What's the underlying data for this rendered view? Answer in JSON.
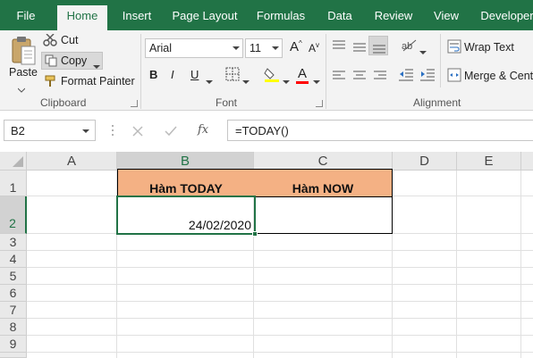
{
  "tabs": [
    "File",
    "Home",
    "Insert",
    "Page Layout",
    "Formulas",
    "Data",
    "Review",
    "View",
    "Developer"
  ],
  "active_tab": "Home",
  "clipboard": {
    "paste_label": "Paste",
    "cut_label": "Cut",
    "copy_label": "Copy",
    "format_painter_label": "Format Painter",
    "group_label": "Clipboard"
  },
  "font": {
    "font_name": "Arial",
    "font_size": "11",
    "bold_label": "B",
    "italic_label": "I",
    "underline_label": "U",
    "font_color_label": "A",
    "group_label": "Font",
    "highlight_color": "#ffff00",
    "font_color": "#ff0000"
  },
  "alignment": {
    "wrap_text_label": "Wrap Text",
    "merge_label": "Merge & Cente",
    "group_label": "Alignment"
  },
  "formula_bar": {
    "name_box": "B2",
    "fx_label": "fx",
    "formula": "=TODAY()"
  },
  "columns": [
    "A",
    "B",
    "C",
    "D",
    "E"
  ],
  "rows": [
    "1",
    "2",
    "3",
    "4",
    "5",
    "6",
    "7",
    "8",
    "9"
  ],
  "cells": {
    "B1": "Hàm TODAY",
    "C1": "Hàm NOW",
    "B2": "24/02/2020",
    "C2": ""
  },
  "colors": {
    "accent": "#217346",
    "header_fill": "#f4b184"
  }
}
